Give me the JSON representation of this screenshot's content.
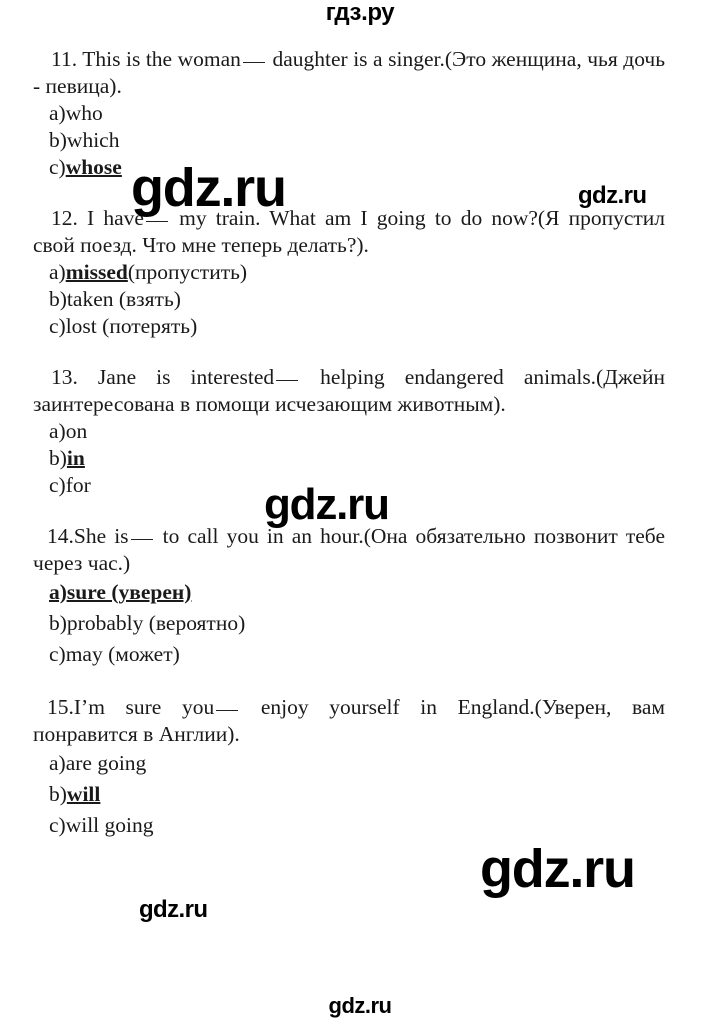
{
  "site": {
    "logo": "гдз.ру",
    "watermark": "gdz.ru"
  },
  "watermarks": [
    {
      "id": "wm-a",
      "text": "gdz.ru"
    },
    {
      "id": "wm-b",
      "text": "gdz.ru"
    },
    {
      "id": "wm-c",
      "text": "gdz.ru"
    },
    {
      "id": "wm-d",
      "text": "gdz.ru"
    },
    {
      "id": "wm-e",
      "text": "gdz.ru"
    },
    {
      "id": "wm-f",
      "text": "gdz.ru"
    }
  ],
  "questions": [
    {
      "number": "11.",
      "prompt_before": "This is the woman",
      "prompt_after": "daughter is a singer.(Это женщина, чья дочь - певица).",
      "options": [
        {
          "label": "a)",
          "text": "who",
          "answer": false
        },
        {
          "label": "b)",
          "text": "which",
          "answer": false
        },
        {
          "label": "c)",
          "text": "whose",
          "answer": true
        }
      ]
    },
    {
      "number": "12.",
      "prompt_before": "I have",
      "prompt_after": "my train. What am I going to do now?(Я пропустил свой поезд. Что мне теперь делать?).",
      "options": [
        {
          "label": "a)",
          "text": "missed",
          "tail": "(пропустить)",
          "answer": true
        },
        {
          "label": "b)",
          "text": "taken",
          "tail": " (взять)",
          "answer": false
        },
        {
          "label": "c)",
          "text": "lost",
          "tail": " (потерять)",
          "answer": false
        }
      ]
    },
    {
      "number": "13.",
      "prompt_before": "Jane is interested",
      "prompt_after": "helping endangered animals.(Джейн заинтересована в помощи исчезающим животным).",
      "options": [
        {
          "label": "a)",
          "text": "on",
          "answer": false
        },
        {
          "label": "b)",
          "text": "in",
          "answer": true
        },
        {
          "label": "c)",
          "text": "for",
          "answer": false
        }
      ]
    },
    {
      "number": "14.",
      "prompt_before": "She is",
      "prompt_after": "to call you in an hour.(Она обязательно позвонит тебе через час.)",
      "options": [
        {
          "label": "a)",
          "text": "sure (уверен)",
          "answer": true,
          "label_in_answer": true
        },
        {
          "label": "b)",
          "text": "probably (вероятно)",
          "answer": false
        },
        {
          "label": "c)",
          "text": "may (может)",
          "answer": false
        }
      ]
    },
    {
      "number": "15.",
      "prompt_before": "I’m sure you",
      "prompt_after": "enjoy yourself in England.(Уверен, вам понравится в Англии).",
      "options": [
        {
          "label": "a)",
          "text": "are going",
          "answer": false
        },
        {
          "label": "b)",
          "text": "will",
          "answer": true
        },
        {
          "label": "c)",
          "text": "will going",
          "answer": false
        }
      ]
    }
  ]
}
